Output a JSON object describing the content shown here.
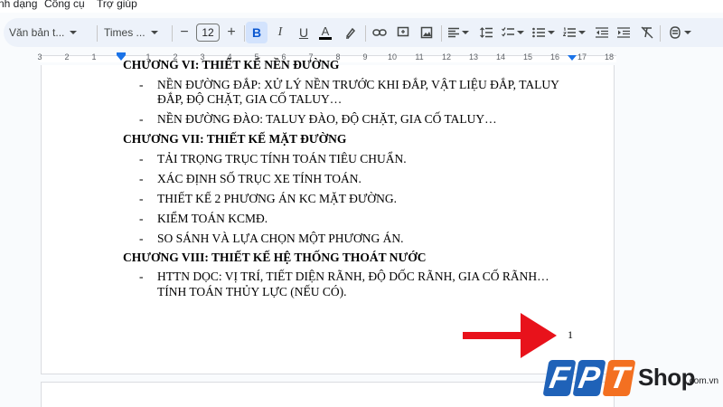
{
  "menu": {
    "items": [
      "nh dạng",
      "Công cụ",
      "Trợ giúp"
    ]
  },
  "toolbar": {
    "style_dropdown": "Văn bản t...",
    "font_dropdown": "Times ...",
    "font_size": "12",
    "decrease_size": "−",
    "increase_size": "+",
    "bold": "B",
    "italic": "I",
    "underline": "U",
    "text_color": "A",
    "text_color_value": "#000000",
    "icons": [
      "highlighter-icon",
      "link-icon",
      "comment-icon",
      "image-icon",
      "align-icon",
      "line-spacing-icon",
      "checklist-icon",
      "bulleted-list-icon",
      "numbered-list-icon",
      "indent-decrease-icon",
      "indent-increase-icon",
      "clear-formatting-icon",
      "editing-mode-icon"
    ]
  },
  "ruler": {
    "numbers": [
      "3",
      "2",
      "1",
      "1",
      "2",
      "3",
      "4",
      "5",
      "6",
      "7",
      "8",
      "9",
      "10",
      "11",
      "12",
      "13",
      "14",
      "15",
      "16",
      "17",
      "18"
    ]
  },
  "document": {
    "lines": {
      "h6": "CHƯƠNG VI: THIẾT KẾ NỀN ĐƯỜNG",
      "b1a": "NỀN ĐƯỜNG ĐẮP: XỬ LÝ NỀN TRƯỚC KHI ĐẮP, VẬT LIỆU ĐẮP, TALUY",
      "b1b": "ĐẮP, ĐỘ CHẶT, GIA CỐ TALUY…",
      "b2": "NỀN ĐƯỜNG ĐÀO: TALUY ĐÀO, ĐỘ CHẶT, GIA CỐ TALUY…",
      "h7": "CHƯƠNG VII: THIẾT KẾ MẶT ĐƯỜNG",
      "b3": "TẢI TRỌNG TRỤC TÍNH TOÁN TIÊU CHUẨN.",
      "b4": "XÁC ĐỊNH SỐ TRỤC XE TÍNH TOÁN.",
      "b5": "THIẾT KẾ 2 PHƯƠNG ÁN KC MẶT ĐƯỜNG.",
      "b6": "KIỂM TOÁN KCMĐ.",
      "b7": "SO SÁNH VÀ LỰA CHỌN MỘT PHƯƠNG ÁN.",
      "h8": "CHƯƠNG VIII: THIẾT KẾ HỆ THỐNG THOÁT NƯỚC",
      "b8a": "HTTN DỌC: VỊ TRÍ, TIẾT DIỆN RÃNH, ĐỘ DỐC RÃNH, GIA CỐ RÃNH…",
      "b8b": "TÍNH TOÁN THỦY LỰC (NẾU CÓ)."
    },
    "bullet_char": "-",
    "page_number": "1"
  },
  "annotation": {
    "arrow_color": "#e8121b"
  },
  "logo": {
    "letters": [
      "F",
      "P",
      "T"
    ],
    "tile_colors": [
      "#1f62b8",
      "#1f62b8",
      "#f37021"
    ],
    "shop_text": "Shop",
    "domain_text": ".com.vn"
  },
  "colors": {
    "toolbar_bg": "#edf2fa",
    "active_button_bg": "#d3e3fd",
    "ruler_marker": "#1a73e8",
    "app_bg": "#f9fbfd"
  }
}
